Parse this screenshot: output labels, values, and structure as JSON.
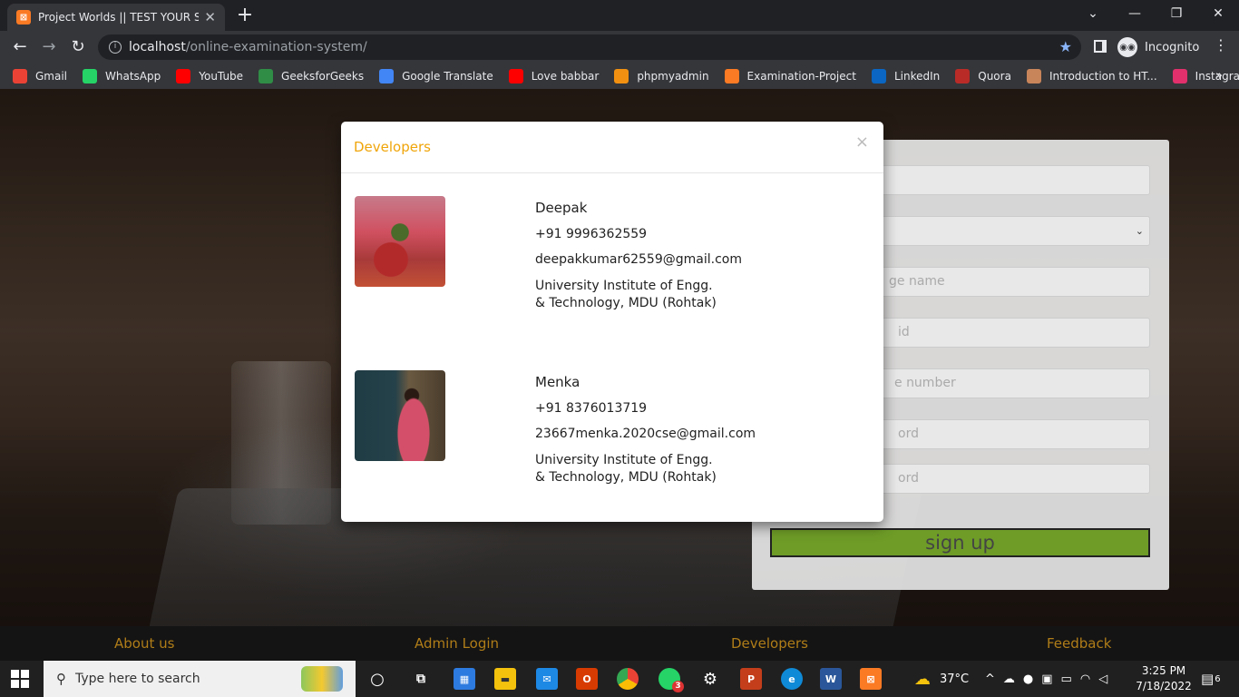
{
  "browser": {
    "tab_title": "Project Worlds || TEST YOUR SKIL",
    "tab_icon": "xampp-icon",
    "url_host": "localhost",
    "url_path": "/online-examination-system/",
    "profile_label": "Incognito"
  },
  "bookmarks": [
    {
      "label": "Gmail",
      "icon": "gmail-icon",
      "color": "#ea4335"
    },
    {
      "label": "WhatsApp",
      "icon": "whatsapp-icon",
      "color": "#25d366"
    },
    {
      "label": "YouTube",
      "icon": "youtube-icon",
      "color": "#ff0000"
    },
    {
      "label": "GeeksforGeeks",
      "icon": "geeksforgeeks-icon",
      "color": "#2f8d46"
    },
    {
      "label": "Google Translate",
      "icon": "google-translate-icon",
      "color": "#4285f4"
    },
    {
      "label": "Love babbar",
      "icon": "youtube-icon",
      "color": "#ff0000"
    },
    {
      "label": "phpmyadmin",
      "icon": "phpmyadmin-icon",
      "color": "#f29111"
    },
    {
      "label": "Examination-Project",
      "icon": "xampp-icon",
      "color": "#fb7a24"
    },
    {
      "label": "LinkedIn",
      "icon": "linkedin-icon",
      "color": "#0a66c2"
    },
    {
      "label": "Quora",
      "icon": "quora-icon",
      "color": "#b92b27"
    },
    {
      "label": "Introduction to HT...",
      "icon": "avatar-icon",
      "color": "#c9855a"
    },
    {
      "label": "Instagram",
      "icon": "instagram-icon",
      "color": "#e1306c"
    }
  ],
  "signup": {
    "field_2_text": "",
    "field_3_text": "ge name",
    "field_4_text": "id",
    "field_5_text": "e number",
    "field_6_text": "ord",
    "field_7_text": "ord",
    "button_label": "sign up",
    "button_color": "#6e9c27"
  },
  "modal": {
    "title": "Developers",
    "close_label": "×",
    "title_color": "#f0a50a",
    "developers": [
      {
        "name": "Deepak",
        "phone": "+91 9996362559",
        "email": "deepakkumar62559@gmail.com",
        "institute_line1": "University Institute of Engg.",
        "institute_line2": "& Technology, MDU (Rohtak)"
      },
      {
        "name": "Menka",
        "phone": "+91 8376013719",
        "email": "23667menka.2020cse@gmail.com",
        "institute_line1": "University Institute of Engg.",
        "institute_line2": "& Technology, MDU (Rohtak)"
      }
    ]
  },
  "footer": {
    "about": "About us",
    "admin": "Admin Login",
    "developers": "Developers",
    "feedback": "Feedback",
    "link_color": "#b07d18"
  },
  "taskbar": {
    "search_placeholder": "Type here to search",
    "whatsapp_badge": "3",
    "temperature": "37°C",
    "time": "3:25 PM",
    "date": "7/18/2022",
    "notification_count": "6"
  }
}
